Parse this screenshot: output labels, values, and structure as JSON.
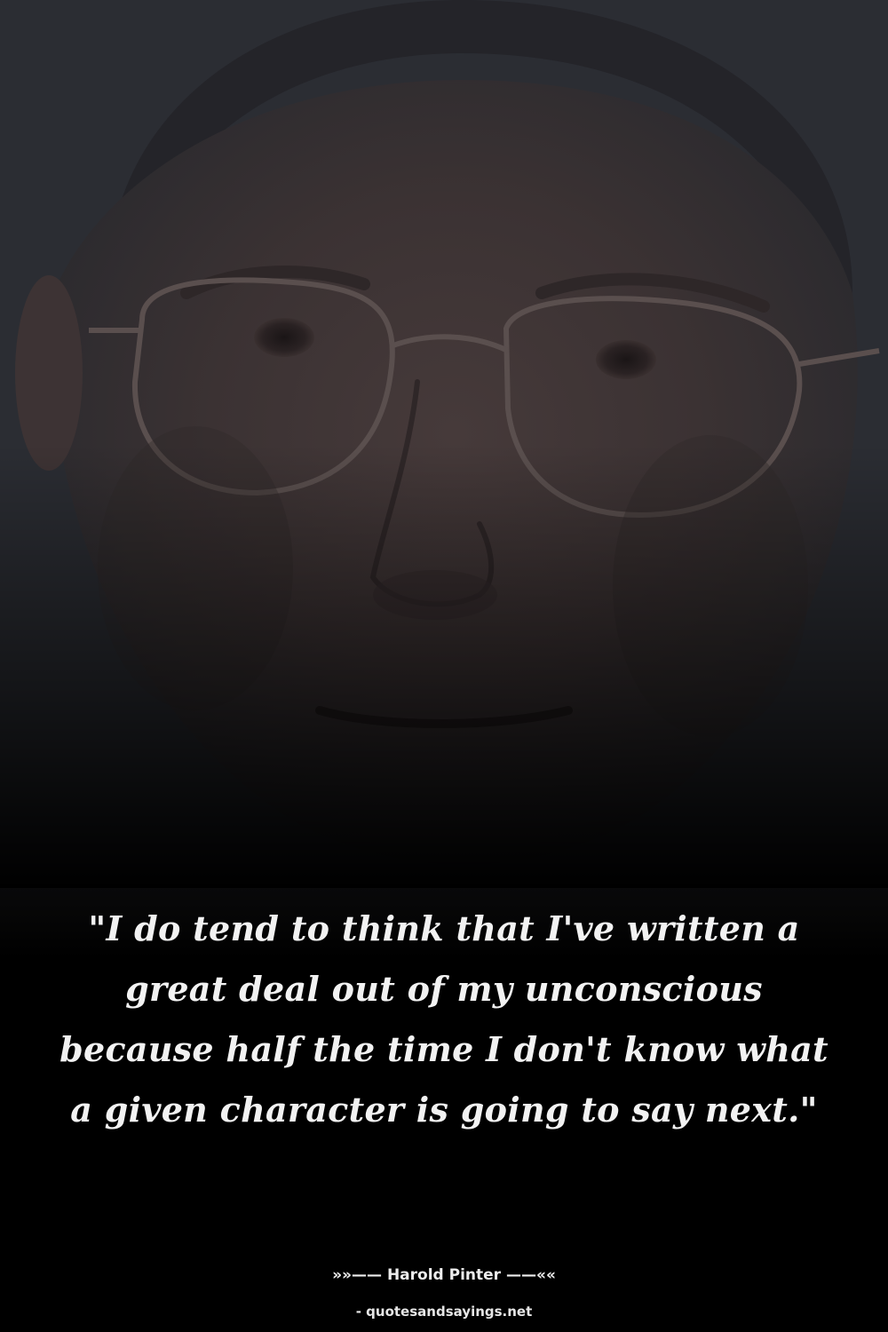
{
  "quote": {
    "text": "\"I do tend to think that I've written a great deal out of my unconscious because half the time I don't know what a given character is going to say next.\""
  },
  "attribution": {
    "line": "»»—— Harold Pinter ——««"
  },
  "source": {
    "text": "- quotesandsayings.net"
  },
  "colors": {
    "background": "#000000",
    "photo_tone": "#2b2c31",
    "text": "#f2f2f2"
  }
}
